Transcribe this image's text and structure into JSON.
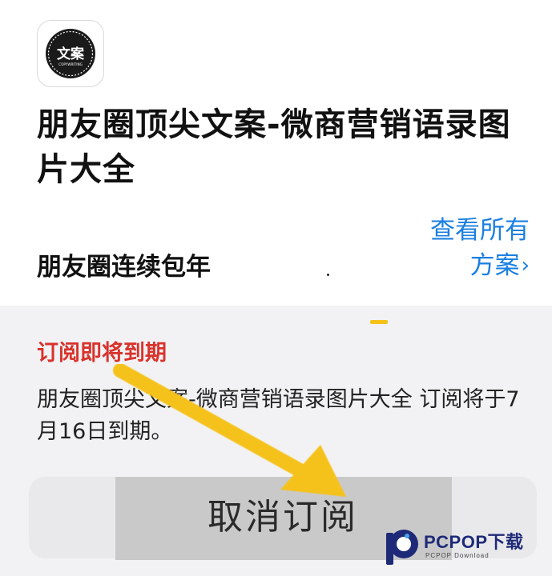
{
  "app": {
    "icon_text": "文案",
    "icon_subtext": "COPYWRITING",
    "name": "朋友圈顶尖文案-微商营销语录图片大全"
  },
  "plan": {
    "name": "朋友圈连续包年",
    "view_all_label": "查看所有方案",
    "view_all_chevron": "›"
  },
  "notice": {
    "title": "订阅即将到期",
    "text": "朋友圈顶尖文案-微商营销语录图片大全 订阅将于7月16日到期。"
  },
  "cancel_button": {
    "label": "取消订阅"
  },
  "watermark": {
    "brand": "PCPOP下载",
    "sub": "PCPOP Download"
  },
  "colors": {
    "link": "#1a7fe0",
    "warning": "#d8332c",
    "arrow": "#f5c21b",
    "watermark": "#1e2a78"
  }
}
